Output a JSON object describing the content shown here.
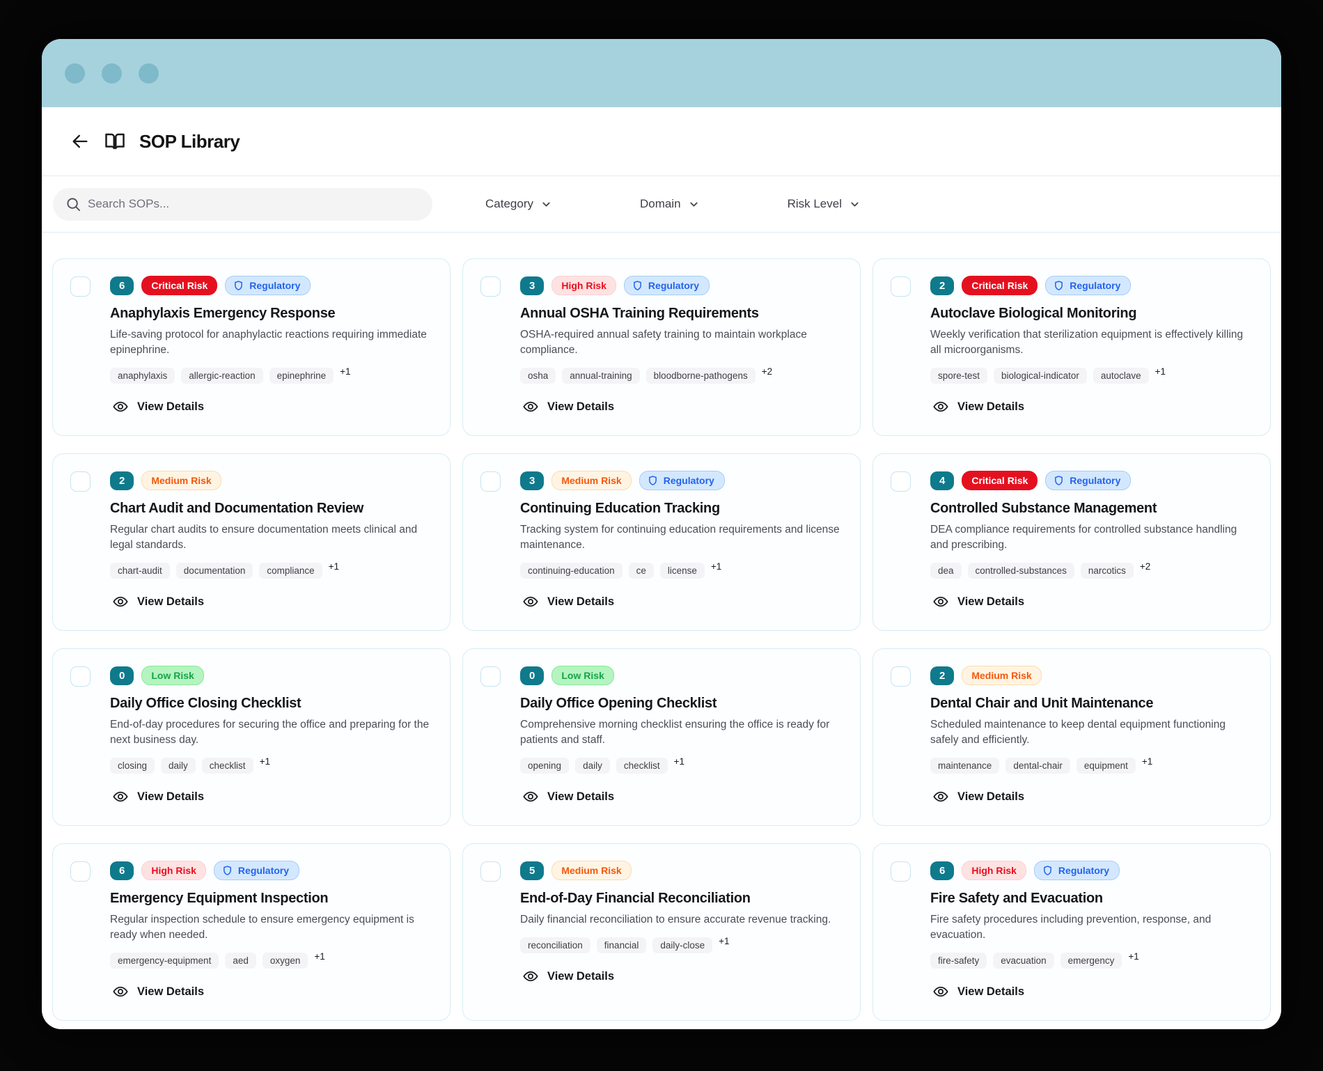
{
  "window": {
    "dots": 3
  },
  "header": {
    "title": "SOP Library"
  },
  "toolbar": {
    "search_placeholder": "Search SOPs...",
    "filters": [
      {
        "label": "Category"
      },
      {
        "label": "Domain"
      },
      {
        "label": "Risk Level"
      }
    ]
  },
  "labels": {
    "regulatory": "Regulatory",
    "view_details": "View Details"
  },
  "icons": {
    "back": "arrow-left-icon",
    "app": "open-book-icon",
    "search": "search-icon",
    "filter_chevron": "chevron-down-icon",
    "regulatory": "shield-icon",
    "view": "eye-icon"
  },
  "colors": {
    "titlebar_bg": "#a6d2de",
    "titlebar_dot": "#7fbaca",
    "count_badge": "#0e7a8c",
    "critical_bg": "#e5101f",
    "critical_fg": "#ffffff",
    "high_bg": "#fee2e2",
    "high_fg": "#e8101f",
    "medium_bg": "#fff4e3",
    "medium_fg": "#f4590c",
    "low_bg": "#b5f4c0",
    "low_fg": "#16a34a",
    "regulatory_bg": "#d3e8fe",
    "regulatory_fg": "#2563eb"
  },
  "cards": [
    {
      "count": "6",
      "risk_label": "Critical Risk",
      "risk_level": "critical",
      "regulatory": true,
      "title": "Anaphylaxis Emergency Response",
      "description": "Life-saving protocol for anaphylactic reactions requiring immediate epinephrine.",
      "tags": [
        "anaphylaxis",
        "allergic-reaction",
        "epinephrine"
      ],
      "more": "+1"
    },
    {
      "count": "3",
      "risk_label": "High Risk",
      "risk_level": "high",
      "regulatory": true,
      "title": "Annual OSHA Training Requirements",
      "description": "OSHA-required annual safety training to maintain workplace compliance.",
      "tags": [
        "osha",
        "annual-training",
        "bloodborne-pathogens"
      ],
      "more": "+2"
    },
    {
      "count": "2",
      "risk_label": "Critical Risk",
      "risk_level": "critical",
      "regulatory": true,
      "title": "Autoclave Biological Monitoring",
      "description": "Weekly verification that sterilization equipment is effectively killing all microorganisms.",
      "tags": [
        "spore-test",
        "biological-indicator",
        "autoclave"
      ],
      "more": "+1"
    },
    {
      "count": "2",
      "risk_label": "Medium Risk",
      "risk_level": "medium",
      "regulatory": false,
      "title": "Chart Audit and Documentation Review",
      "description": "Regular chart audits to ensure documentation meets clinical and legal standards.",
      "tags": [
        "chart-audit",
        "documentation",
        "compliance"
      ],
      "more": "+1"
    },
    {
      "count": "3",
      "risk_label": "Medium Risk",
      "risk_level": "medium",
      "regulatory": true,
      "title": "Continuing Education Tracking",
      "description": "Tracking system for continuing education requirements and license maintenance.",
      "tags": [
        "continuing-education",
        "ce",
        "license"
      ],
      "more": "+1"
    },
    {
      "count": "4",
      "risk_label": "Critical Risk",
      "risk_level": "critical",
      "regulatory": true,
      "title": "Controlled Substance Management",
      "description": "DEA compliance requirements for controlled substance handling and prescribing.",
      "tags": [
        "dea",
        "controlled-substances",
        "narcotics"
      ],
      "more": "+2"
    },
    {
      "count": "0",
      "risk_label": "Low Risk",
      "risk_level": "low",
      "regulatory": false,
      "title": "Daily Office Closing Checklist",
      "description": "End-of-day procedures for securing the office and preparing for the next business day.",
      "tags": [
        "closing",
        "daily",
        "checklist"
      ],
      "more": "+1"
    },
    {
      "count": "0",
      "risk_label": "Low Risk",
      "risk_level": "low",
      "regulatory": false,
      "title": "Daily Office Opening Checklist",
      "description": "Comprehensive morning checklist ensuring the office is ready for patients and staff.",
      "tags": [
        "opening",
        "daily",
        "checklist"
      ],
      "more": "+1"
    },
    {
      "count": "2",
      "risk_label": "Medium Risk",
      "risk_level": "medium",
      "regulatory": false,
      "title": "Dental Chair and Unit Maintenance",
      "description": "Scheduled maintenance to keep dental equipment functioning safely and efficiently.",
      "tags": [
        "maintenance",
        "dental-chair",
        "equipment"
      ],
      "more": "+1"
    },
    {
      "count": "6",
      "risk_label": "High Risk",
      "risk_level": "high",
      "regulatory": true,
      "title": "Emergency Equipment Inspection",
      "description": "Regular inspection schedule to ensure emergency equipment is ready when needed.",
      "tags": [
        "emergency-equipment",
        "aed",
        "oxygen"
      ],
      "more": "+1"
    },
    {
      "count": "5",
      "risk_label": "Medium Risk",
      "risk_level": "medium",
      "regulatory": false,
      "title": "End-of-Day Financial Reconciliation",
      "description": "Daily financial reconciliation to ensure accurate revenue tracking.",
      "tags": [
        "reconciliation",
        "financial",
        "daily-close"
      ],
      "more": "+1"
    },
    {
      "count": "6",
      "risk_label": "High Risk",
      "risk_level": "high",
      "regulatory": true,
      "title": "Fire Safety and Evacuation",
      "description": "Fire safety procedures including prevention, response, and evacuation.",
      "tags": [
        "fire-safety",
        "evacuation",
        "emergency"
      ],
      "more": "+1"
    }
  ]
}
